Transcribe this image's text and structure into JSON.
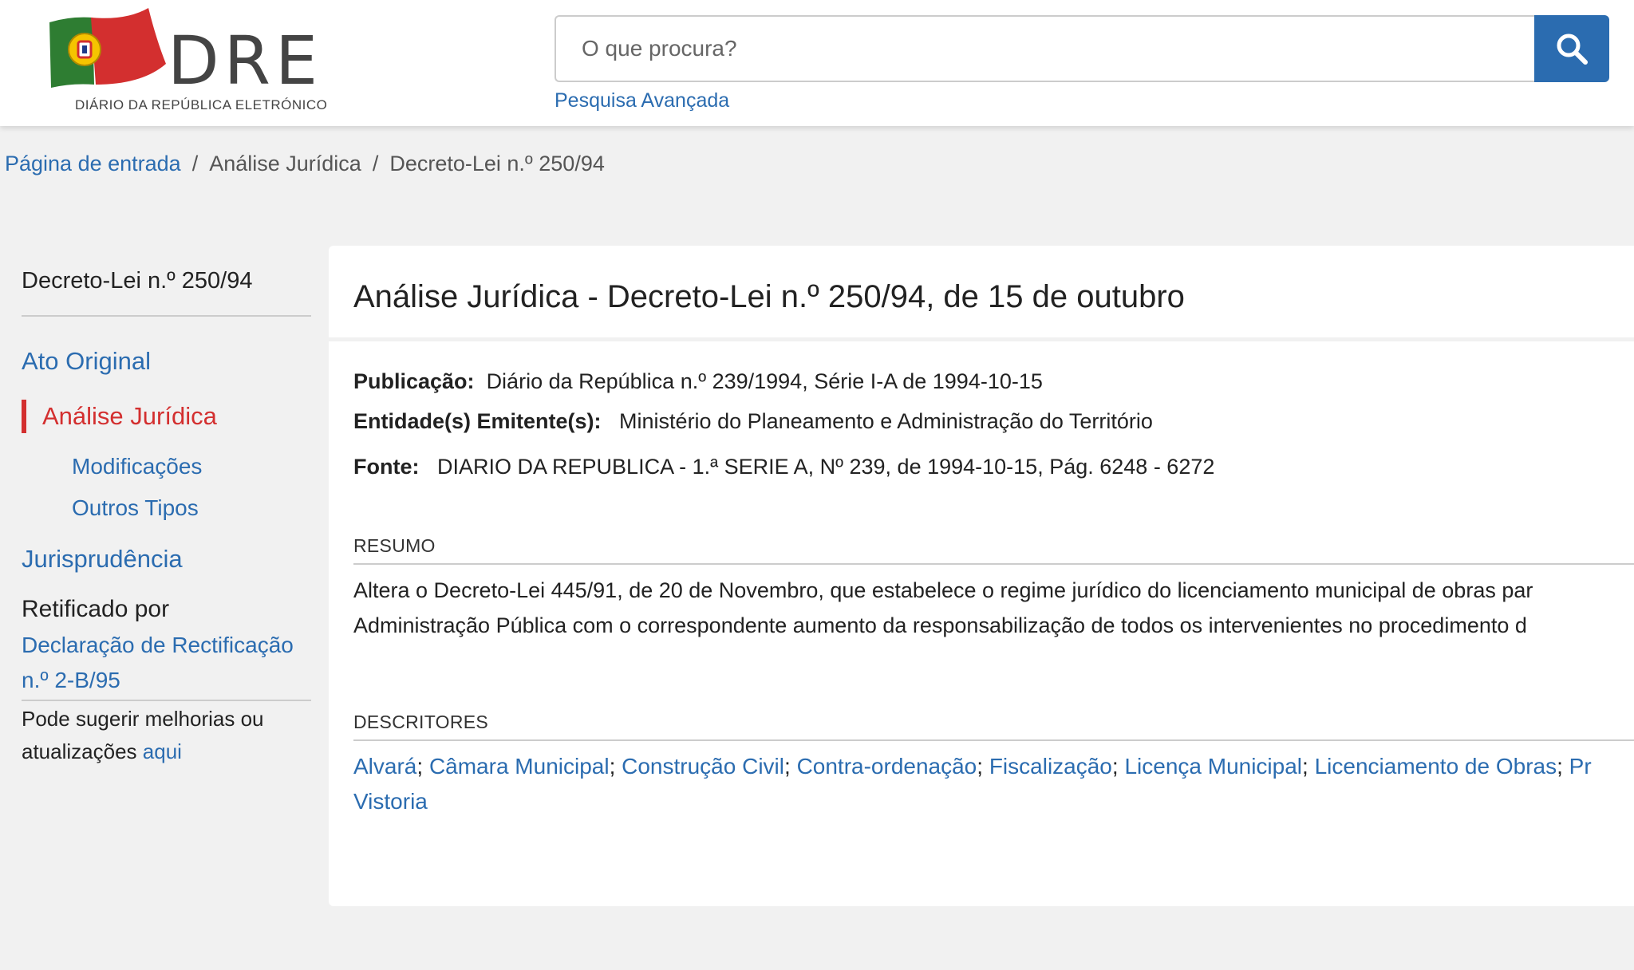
{
  "header": {
    "logo_text": "DRE",
    "logo_subtitle": "DIÁRIO DA REPÚBLICA ELETRÓNICO",
    "search_placeholder": "O que procura?",
    "advanced_search": "Pesquisa Avançada",
    "accent_color": "#2b6cb0"
  },
  "breadcrumb": {
    "home": "Página de entrada",
    "section": "Análise Jurídica",
    "current": "Decreto-Lei n.º 250/94",
    "separator": "/"
  },
  "sidebar": {
    "title": "Decreto-Lei n.º 250/94",
    "ato_original": "Ato Original",
    "analise_juridica": "Análise Jurídica",
    "modificacoes": "Modificações",
    "outros_tipos": "Outros Tipos",
    "jurisprudencia": "Jurisprudência",
    "retificado_por": "Retificado por",
    "retificacao_line1": "Declaração de Rectificação",
    "retificacao_line2": "n.º 2-B/95",
    "suggest_line1": "Pode sugerir melhorias ou",
    "suggest_line2": "atualizações",
    "suggest_link": "aqui"
  },
  "main": {
    "title": "Análise Jurídica - Decreto-Lei n.º 250/94, de 15 de outubro",
    "publicacao_label": "Publicação:",
    "publicacao_value": "Diário da República n.º 239/1994, Série I-A de 1994-10-15",
    "entidade_label": "Entidade(s) Emitente(s):",
    "entidade_value": "Ministério do Planeamento e Administração do Território",
    "fonte_label": "Fonte:",
    "fonte_value": "DIARIO DA REPUBLICA - 1.ª SERIE A, Nº 239, de 1994-10-15, Pág. 6248 - 6272",
    "resumo_label": "RESUMO",
    "resumo_line1": "Altera o Decreto-Lei 445/91, de 20 de Novembro, que estabelece o regime jurídico do licenciamento municipal de obras par",
    "resumo_line2": "Administração Pública com o correspondente aumento da responsabilização de todos os intervenientes no procedimento d",
    "descritores_label": "DESCRITORES",
    "descritores": [
      "Alvará",
      "Câmara Municipal",
      "Construção Civil",
      "Contra-ordenação",
      "Fiscalização",
      "Licença Municipal",
      "Licenciamento de Obras",
      "Pr"
    ],
    "descritor_line2": "Vistoria",
    "descritor_separator": ";"
  }
}
